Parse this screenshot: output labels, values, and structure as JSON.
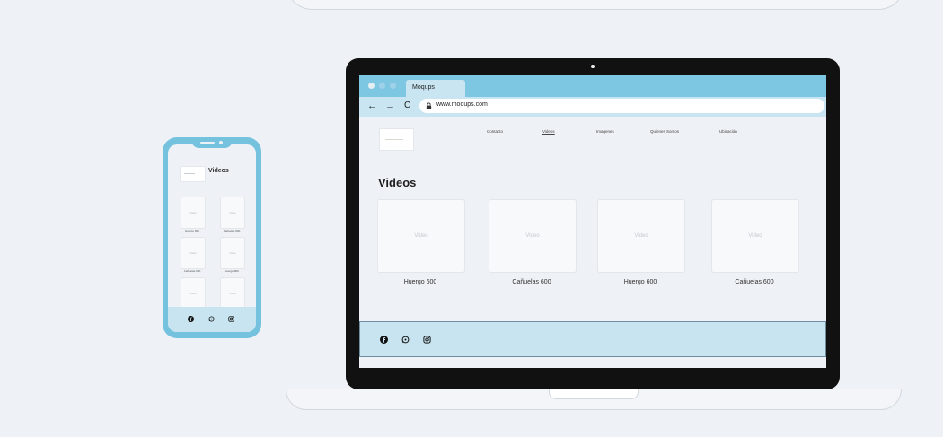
{
  "phone": {
    "title": "Videos",
    "cards": [
      {
        "placeholder": "Video",
        "caption": "Huergo 600"
      },
      {
        "placeholder": "Video",
        "caption": "Cañuelas 600"
      },
      {
        "placeholder": "Video",
        "caption": "Cañuelas 600"
      },
      {
        "placeholder": "Video",
        "caption": "Huergo 600"
      },
      {
        "placeholder": "Video",
        "caption": ""
      },
      {
        "placeholder": "Video",
        "caption": ""
      }
    ],
    "footer_icons": [
      "facebook-icon",
      "whatsapp-icon",
      "instagram-icon"
    ]
  },
  "browser": {
    "tab_title": "Moqups",
    "url": "www.moqups.com",
    "back_glyph": "←",
    "forward_glyph": "→",
    "reload_glyph": "C",
    "dot_colors": [
      "#e5eef3",
      "#9fd2e8",
      "#9fd2e8"
    ]
  },
  "site": {
    "nav": [
      "Contacto",
      "Videos",
      "Imagenes",
      "Quienes Somos",
      "Ubicación"
    ],
    "active_nav": "Videos",
    "title": "Videos",
    "videos": [
      {
        "placeholder": "Video",
        "caption": "Huergo 600"
      },
      {
        "placeholder": "Video",
        "caption": "Cañuelas 600"
      },
      {
        "placeholder": "Video",
        "caption": "Huergo 600"
      },
      {
        "placeholder": "Video",
        "caption": "Cañuelas 600"
      }
    ],
    "footer_icons": [
      "facebook-icon",
      "whatsapp-icon",
      "instagram-icon"
    ]
  },
  "colors": {
    "accent": "#7ec7e3",
    "phone_frame": "#74c2de",
    "footer_bg": "#c7e4f0",
    "laptop_bezel": "#111111"
  }
}
